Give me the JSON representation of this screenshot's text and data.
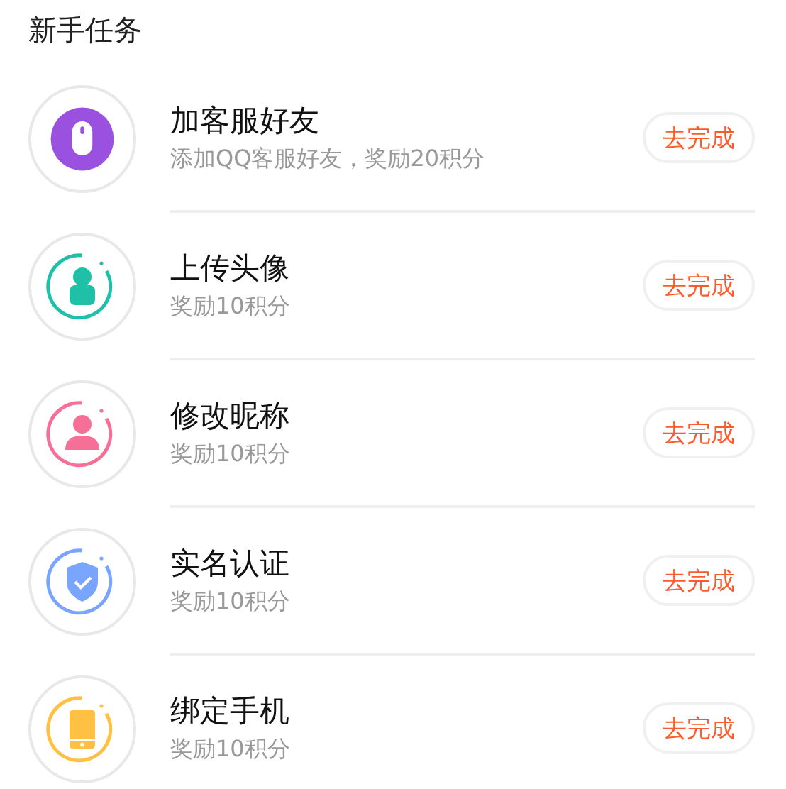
{
  "heading": "新手任务",
  "tasks": [
    {
      "kind": "mouse",
      "color": "#9b51e0",
      "title": "加客服好友",
      "subtitle": "添加QQ客服好友，奖励20积分",
      "button": "去完成"
    },
    {
      "kind": "avatar",
      "color": "#1fbfa8",
      "title": "上传头像",
      "subtitle": "奖励10积分",
      "button": "去完成"
    },
    {
      "kind": "person",
      "color": "#f56f97",
      "title": "修改昵称",
      "subtitle": "奖励10积分",
      "button": "去完成"
    },
    {
      "kind": "shield",
      "color": "#7aa5ff",
      "title": "实名认证",
      "subtitle": "奖励10积分",
      "button": "去完成"
    },
    {
      "kind": "phone",
      "color": "#ffc043",
      "title": "绑定手机",
      "subtitle": "奖励10积分",
      "button": "去完成"
    }
  ]
}
